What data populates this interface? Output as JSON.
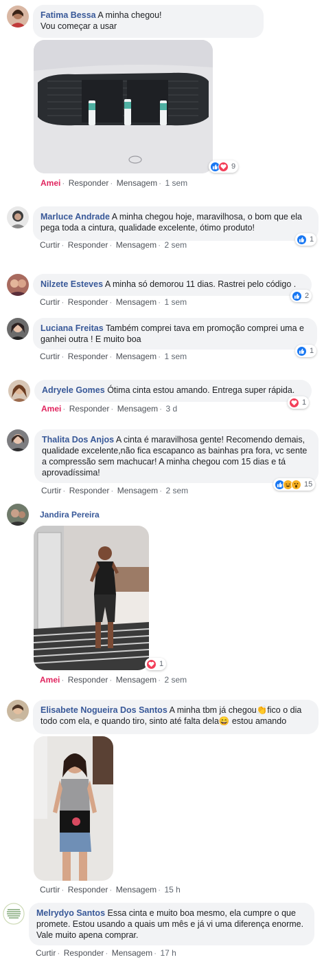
{
  "comments": [
    {
      "name": "Fatima Bessa",
      "text": "A minha chegou!\nVou começar a usar",
      "actions": [
        "Amei",
        "Responder",
        "Mensagem",
        "1 sem"
      ],
      "reaction_count": "9"
    },
    {
      "name": "Marluce Andrade",
      "text": "A minha chegou hoje, maravilhosa, o bom que ela pega toda a cintura, qualidade excelente, ótimo produto!",
      "actions": [
        "Curtir",
        "Responder",
        "Mensagem",
        "2 sem"
      ],
      "reaction_count": "1"
    },
    {
      "name": "Nilzete Esteves",
      "text": "A minha só demorou 11 dias. Rastrei pelo código .",
      "actions": [
        "Curtir",
        "Responder",
        "Mensagem",
        "1 sem"
      ],
      "reaction_count": "2"
    },
    {
      "name": "Luciana Freitas",
      "text": "Também comprei tava em promoção comprei uma e ganhei outra ! E muito boa",
      "actions": [
        "Curtir",
        "Responder",
        "Mensagem",
        "1 sem"
      ],
      "reaction_count": "1"
    },
    {
      "name": "Adryele Gomes",
      "text": "Ótima cinta estou amando. Entrega super rápida.",
      "actions": [
        "Amei",
        "Responder",
        "Mensagem",
        "3 d"
      ],
      "reaction_count": "1"
    },
    {
      "name": "Thalita Dos Anjos",
      "text": "A cinta é maravilhosa gente! Recomendo demais, qualidade excelente,não fica escapanco as bainhas pra fora, vc sente a compressão sem machucar! A minha chegou com 15 dias e tá aprovadíssima!",
      "actions": [
        "Curtir",
        "Responder",
        "Mensagem",
        "2 sem"
      ],
      "reaction_count": "15"
    },
    {
      "name": "Jandira Pereira",
      "text": "",
      "actions": [
        "Amei",
        "Responder",
        "Mensagem",
        "2 sem"
      ],
      "reaction_count": "1"
    },
    {
      "name": "Elisabete Nogueira Dos Santos",
      "text": "A minha tbm já chegou👏fico o dia todo com ela, e quando tiro, sinto até falta dela😄 estou amando",
      "actions": [
        "Curtir",
        "Responder",
        "Mensagem",
        "15 h"
      ],
      "reaction_count": ""
    },
    {
      "name": "Melrydyo Santos",
      "text": "Essa cinta e muito boa mesmo, ela cumpre o que promete. Estou usando a quais um mês e já vi uma diferença enorme. Vale muito apena comprar.",
      "actions": [
        "Curtir",
        "Responder",
        "Mensagem",
        "17 h"
      ],
      "reaction_count": ""
    }
  ],
  "colors": {
    "name": "#385898",
    "bubble": "#f2f3f5",
    "love": "#e0245e",
    "like": "#1877f2"
  },
  "icons": {
    "like": "like-reaction-icon",
    "love": "love-reaction-icon",
    "haha": "haha-reaction-icon",
    "wow": "wow-reaction-icon"
  }
}
